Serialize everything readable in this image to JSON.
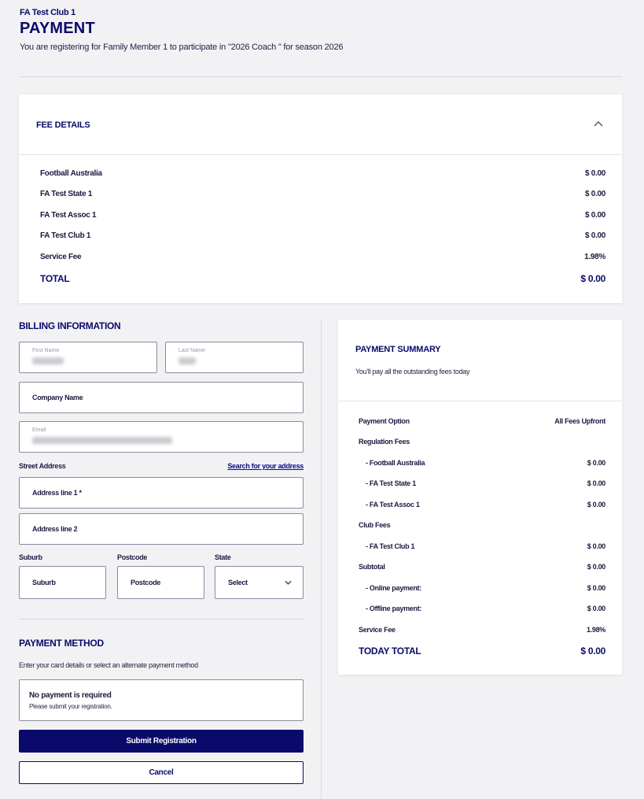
{
  "header": {
    "club_name": "FA Test Club 1",
    "title": "PAYMENT",
    "subtitle": "You are registering for Family Member 1 to participate in \"2026 Coach \" for season 2026"
  },
  "fee_details": {
    "title": "FEE DETAILS",
    "rows": [
      {
        "label": "Football Australia",
        "value": "$ 0.00"
      },
      {
        "label": "FA Test State 1",
        "value": "$ 0.00"
      },
      {
        "label": "FA Test Assoc 1",
        "value": "$ 0.00"
      },
      {
        "label": "FA Test Club 1",
        "value": "$ 0.00"
      },
      {
        "label": "Service Fee",
        "value": "1.98%"
      }
    ],
    "total_label": "TOTAL",
    "total_value": "$ 0.00"
  },
  "billing": {
    "title": "BILLING INFORMATION",
    "first_name_label": "First Name",
    "last_name_label": "Last Name",
    "company_placeholder": "Company Name",
    "email_label": "Email",
    "street_label": "Street Address",
    "search_link": "Search for your address",
    "address1_placeholder": "Address line 1 *",
    "address2_placeholder": "Address line 2",
    "suburb_label": "Suburb",
    "postcode_label": "Postcode",
    "state_label": "State",
    "suburb_placeholder": "Suburb",
    "postcode_placeholder": "Postcode",
    "state_value": "Select"
  },
  "payment_method": {
    "title": "PAYMENT METHOD",
    "description": "Enter your card details or select an alternate payment method",
    "no_payment_title": "No payment is required",
    "no_payment_sub": "Please submit your registration.",
    "submit_label": "Submit Registration",
    "cancel_label": "Cancel"
  },
  "summary": {
    "title": "PAYMENT SUMMARY",
    "subtitle": "You'll pay all the outstanding fees today",
    "rows": [
      {
        "label": "Payment Option",
        "value": "All Fees Upfront"
      },
      {
        "label": "Regulation Fees",
        "value": ""
      },
      {
        "label": "- Football Australia",
        "value": "$ 0.00"
      },
      {
        "label": "- FA Test State 1",
        "value": "$ 0.00"
      },
      {
        "label": "- FA Test Assoc 1",
        "value": "$ 0.00"
      },
      {
        "label": "Club Fees",
        "value": ""
      },
      {
        "label": "- FA Test Club 1",
        "value": "$ 0.00"
      },
      {
        "label": "Subtotal",
        "value": "$ 0.00"
      },
      {
        "label": "- Online payment:",
        "value": "$ 0.00"
      },
      {
        "label": "- Offline payment:",
        "value": "$ 0.00"
      },
      {
        "label": "Service Fee",
        "value": "1.98%"
      }
    ],
    "total_label": "TODAY TOTAL",
    "total_value": "$ 0.00"
  },
  "colors": {
    "navy": "#0a0a6b",
    "background": "#f2f2f4"
  },
  "icons": {
    "fee_toggle": "chevron-up-icon",
    "state_select": "chevron-down-icon"
  }
}
